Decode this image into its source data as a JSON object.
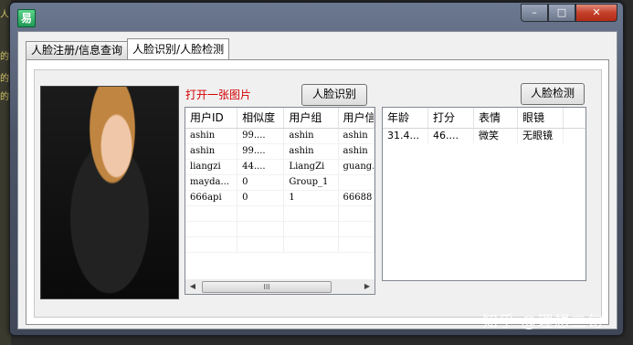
{
  "window": {
    "icon_glyph": "易",
    "controls": {
      "minimize": "–",
      "maximize": "□",
      "close": "✕"
    }
  },
  "background": {
    "left_glyphs": [
      "人",
      "的",
      "的",
      "的"
    ]
  },
  "tabs": [
    {
      "label": "人脸注册/信息查询",
      "active": false
    },
    {
      "label": "人脸识别/人脸检测",
      "active": true
    }
  ],
  "panel": {
    "open_image_label": "打开一张图片",
    "recognize_button": "人脸识别",
    "detect_button": "人脸检测"
  },
  "recognition_table": {
    "columns": [
      "用户ID",
      "相似度",
      "用户组",
      "用户信"
    ],
    "rows": [
      [
        "ashin",
        "99....",
        "ashin",
        "ashin"
      ],
      [
        "ashin",
        "99....",
        "ashin",
        "ashin"
      ],
      [
        "liangzi",
        "44....",
        "LiangZi",
        "guang..."
      ],
      [
        "mayda...",
        "0",
        "Group_1",
        ""
      ],
      [
        "666api",
        "0",
        "1",
        "66688"
      ]
    ],
    "scroll_grip": "III"
  },
  "detection_table": {
    "columns": [
      "年龄",
      "打分",
      "表情",
      "眼镜"
    ],
    "rows": [
      [
        "31.4...",
        "46....",
        "微笑",
        "无眼镜"
      ]
    ]
  },
  "watermark": "知乎 @理想二旬"
}
